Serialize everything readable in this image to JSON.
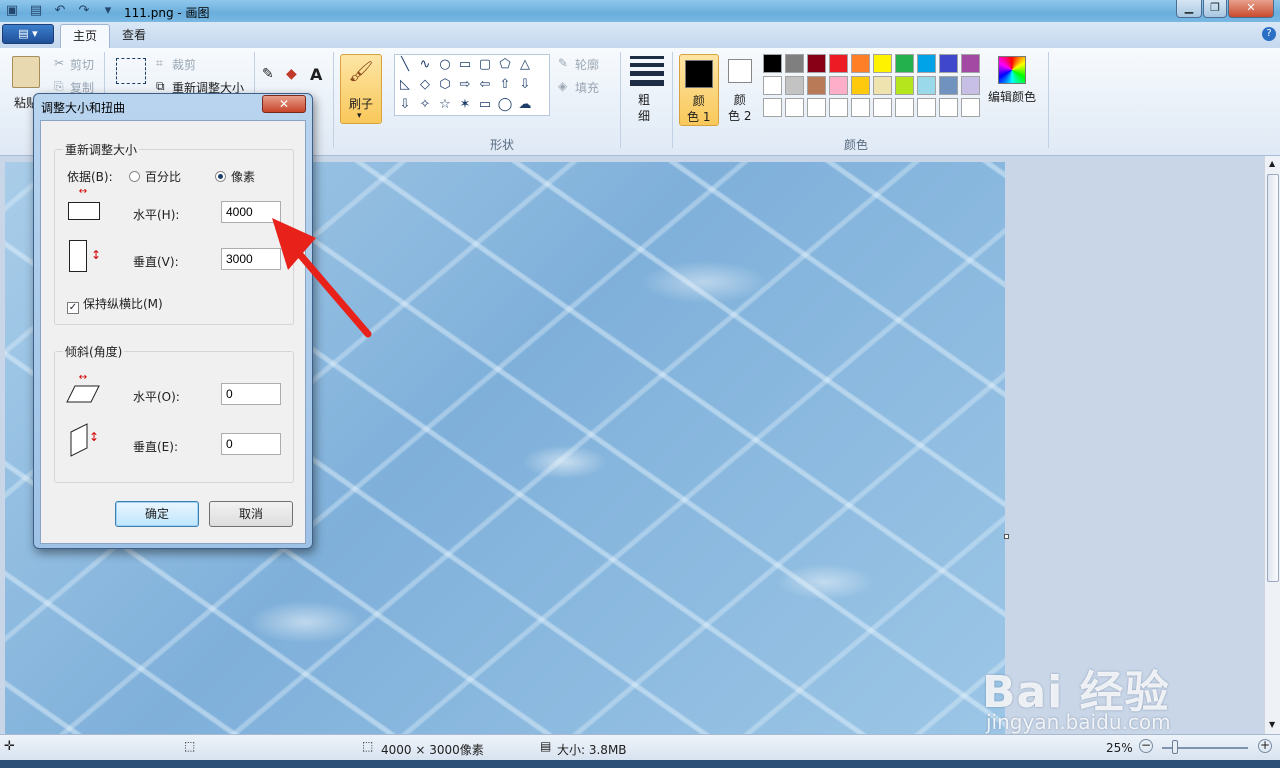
{
  "window": {
    "title": "111.png - 画图"
  },
  "tabs": {
    "home": "主页",
    "view": "查看"
  },
  "clipboard": {
    "paste": "粘贴",
    "cut": "剪切",
    "copy": "复制"
  },
  "image": {
    "crop": "裁剪",
    "resize": "重新调整大小"
  },
  "shapes": {
    "outline": "轮廓",
    "fill": "填充",
    "label": "形状",
    "glyphs": [
      "╲",
      "∿",
      "○",
      "▭",
      "▢",
      "⬠",
      "△",
      "◺",
      "◇",
      "⬡",
      "⇨",
      "⇦",
      "⇧",
      "⇩",
      "⇩",
      "✧",
      "☆",
      "✶",
      "▭",
      "◯",
      "☁"
    ]
  },
  "brush": {
    "label": "刷子"
  },
  "thickness": {
    "label": "粗\n细"
  },
  "colors": {
    "color1": "颜\n色 1",
    "color2": "颜\n色 2",
    "edit": "编辑颜色",
    "label": "颜色",
    "palette": [
      "#000000",
      "#7f7f7f",
      "#880015",
      "#ed1c24",
      "#ff7f27",
      "#fff200",
      "#22b14c",
      "#00a2e8",
      "#3f48cc",
      "#a349a4",
      "#ffffff",
      "#c3c3c3",
      "#b97a57",
      "#ffaec9",
      "#ffc90e",
      "#efe4b0",
      "#b5e61d",
      "#99d9ea",
      "#7092be",
      "#c8bfe7",
      "#ffffff",
      "#ffffff",
      "#ffffff",
      "#ffffff",
      "#ffffff",
      "#ffffff",
      "#ffffff",
      "#ffffff",
      "#ffffff",
      "#ffffff"
    ]
  },
  "dialog": {
    "title": "调整大小和扭曲",
    "resize_group": "重新调整大小",
    "by_label": "依据(B):",
    "percent": "百分比",
    "pixels": "像素",
    "horizontal_label": "水平(H):",
    "horizontal_value": "4000",
    "vertical_label": "垂直(V):",
    "vertical_value": "3000",
    "keep_ratio": "保持纵横比(M)",
    "skew_group": "倾斜(角度)",
    "skew_h_label": "水平(O):",
    "skew_h_value": "0",
    "skew_v_label": "垂直(E):",
    "skew_v_value": "0",
    "ok": "确定",
    "cancel": "取消"
  },
  "status": {
    "dimensions": "4000 × 3000像素",
    "size": "大小: 3.8MB",
    "zoom": "25%"
  },
  "watermark": {
    "brand": "Bai 经验",
    "url": "jingyan.baidu.com"
  }
}
